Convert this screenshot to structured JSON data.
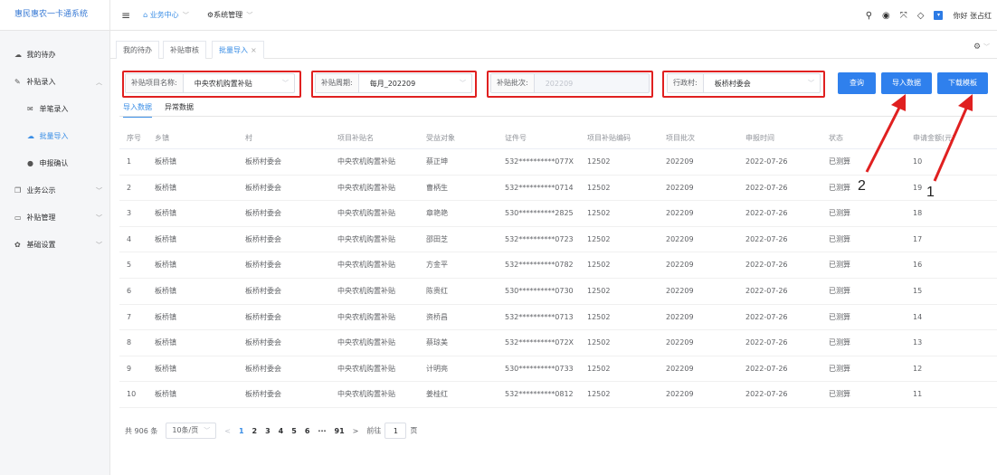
{
  "app": {
    "title": "惠民惠农一卡通系统"
  },
  "sidebar": {
    "items": [
      {
        "label": "我的待办",
        "icon": "cloud-icon"
      },
      {
        "label": "补贴录入",
        "icon": "pencil-icon"
      },
      {
        "label": "单笔录入",
        "icon": "mail-icon"
      },
      {
        "label": "批量导入",
        "icon": "upload-icon"
      },
      {
        "label": "申报确认",
        "icon": "check-circle-icon"
      },
      {
        "label": "业务公示",
        "icon": "copy-icon"
      },
      {
        "label": "补贴管理",
        "icon": "monitor-icon"
      },
      {
        "label": "基础设置",
        "icon": "gear-icon"
      }
    ]
  },
  "header": {
    "nav": [
      {
        "label": "业务中心"
      },
      {
        "label": "系统管理"
      }
    ],
    "greeting": "你好 张占红"
  },
  "tabs": [
    {
      "label": "我的待办"
    },
    {
      "label": "补贴审核"
    },
    {
      "label": "批量导入"
    }
  ],
  "filters": {
    "project": {
      "label": "补贴项目名称:",
      "value": "中央农机购置补贴"
    },
    "period": {
      "label": "补贴周期:",
      "value": "每月_202209"
    },
    "batch": {
      "label": "补贴批次:",
      "value": "202209"
    },
    "village": {
      "label": "行政村:",
      "value": "板桥村委会"
    }
  },
  "buttons": {
    "query": "查询",
    "import": "导入数据",
    "download": "下载模板"
  },
  "subtabs": [
    "导入数据",
    "异常数据"
  ],
  "table": {
    "headers": [
      "序号",
      "乡镇",
      "村",
      "项目补贴名",
      "受益对象",
      "证件号",
      "项目补贴编码",
      "项目批次",
      "申报时间",
      "状态",
      "申请金额(元)"
    ],
    "rows": [
      [
        "1",
        "板桥镇",
        "板桥村委会",
        "中央农机购置补贴",
        "蔡正坤",
        "532**********077X",
        "12502",
        "202209",
        "2022-07-26",
        "已测算",
        "10"
      ],
      [
        "2",
        "板桥镇",
        "板桥村委会",
        "中央农机购置补贴",
        "曹柄生",
        "532**********0714",
        "12502",
        "202209",
        "2022-07-26",
        "已测算",
        "19"
      ],
      [
        "3",
        "板桥镇",
        "板桥村委会",
        "中央农机购置补贴",
        "章艳艳",
        "530**********2825",
        "12502",
        "202209",
        "2022-07-26",
        "已测算",
        "18"
      ],
      [
        "4",
        "板桥镇",
        "板桥村委会",
        "中央农机购置补贴",
        "邵田芝",
        "532**********0723",
        "12502",
        "202209",
        "2022-07-26",
        "已测算",
        "17"
      ],
      [
        "5",
        "板桥镇",
        "板桥村委会",
        "中央农机购置补贴",
        "方金平",
        "532**********0782",
        "12502",
        "202209",
        "2022-07-26",
        "已测算",
        "16"
      ],
      [
        "6",
        "板桥镇",
        "板桥村委会",
        "中央农机购置补贴",
        "陈贵红",
        "530**********0730",
        "12502",
        "202209",
        "2022-07-26",
        "已测算",
        "15"
      ],
      [
        "7",
        "板桥镇",
        "板桥村委会",
        "中央农机购置补贴",
        "资桥昌",
        "532**********0713",
        "12502",
        "202209",
        "2022-07-26",
        "已测算",
        "14"
      ],
      [
        "8",
        "板桥镇",
        "板桥村委会",
        "中央农机购置补贴",
        "蔡琼美",
        "532**********072X",
        "12502",
        "202209",
        "2022-07-26",
        "已测算",
        "13"
      ],
      [
        "9",
        "板桥镇",
        "板桥村委会",
        "中央农机购置补贴",
        "计明亮",
        "530**********0733",
        "12502",
        "202209",
        "2022-07-26",
        "已测算",
        "12"
      ],
      [
        "10",
        "板桥镇",
        "板桥村委会",
        "中央农机购置补贴",
        "姜桂红",
        "532**********0812",
        "12502",
        "202209",
        "2022-07-26",
        "已测算",
        "11"
      ]
    ]
  },
  "pagination": {
    "total": "共 906 条",
    "page_size": "10条/页",
    "pages": [
      "1",
      "2",
      "3",
      "4",
      "5",
      "6",
      "···",
      "91"
    ],
    "goto_label": "前往",
    "goto_value": "1",
    "goto_unit": "页"
  },
  "annotations": {
    "marker_1": "1",
    "marker_2": "2"
  },
  "colors": {
    "primary": "#2f80ed",
    "highlight": "#e02020"
  }
}
